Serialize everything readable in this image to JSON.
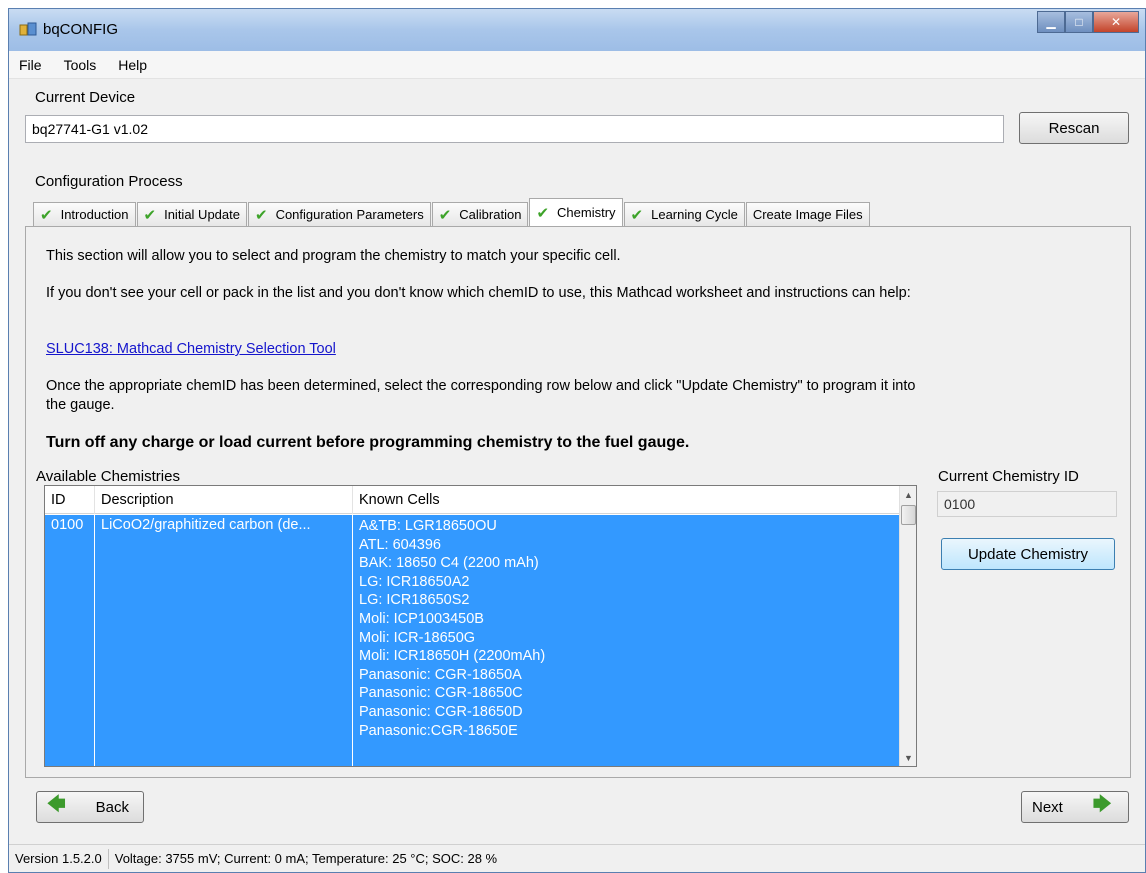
{
  "window": {
    "title": "bqCONFIG"
  },
  "menu": {
    "file": "File",
    "tools": "Tools",
    "help": "Help"
  },
  "current_device": {
    "label": "Current Device",
    "value": "bq27741-G1 v1.02",
    "rescan_label": "Rescan"
  },
  "config": {
    "label": "Configuration Process",
    "tabs": [
      {
        "label": "Introduction",
        "checked": true
      },
      {
        "label": "Initial Update",
        "checked": true
      },
      {
        "label": "Configuration Parameters",
        "checked": true
      },
      {
        "label": "Calibration",
        "checked": true
      },
      {
        "label": "Chemistry",
        "checked": true,
        "active": true
      },
      {
        "label": "Learning Cycle",
        "checked": true
      },
      {
        "label": "Create Image Files",
        "checked": false
      }
    ]
  },
  "chemistry": {
    "intro": "This section will allow you to select and program the chemistry to match your specific cell.",
    "help_text": "If you don't see your cell or pack in the list and you don't know which chemID to use, this Mathcad worksheet and instructions can help:",
    "link": "SLUC138: Mathcad Chemistry Selection Tool",
    "instructions": "Once the appropriate chemID has been determined, select the corresponding row below and click \"Update Chemistry\" to program it into the gauge.",
    "warning": "Turn off any charge or load current before programming chemistry to the fuel gauge.",
    "available_label": "Available Chemistries",
    "columns": {
      "id": "ID",
      "description": "Description",
      "known_cells": "Known Cells"
    },
    "selected_row": {
      "id": "0100",
      "description": "LiCoO2/graphitized carbon (de...",
      "known_cells": [
        "A&TB: LGR18650OU",
        "ATL: 604396",
        "BAK: 18650 C4 (2200 mAh)",
        "LG: ICR18650A2",
        "LG: ICR18650S2",
        "Moli: ICP1003450B",
        "Moli: ICR-18650G",
        "Moli: ICR18650H (2200mAh)",
        "Panasonic: CGR-18650A",
        "Panasonic: CGR-18650C",
        "Panasonic: CGR-18650D",
        "Panasonic:CGR-18650E"
      ]
    },
    "current_id_label": "Current Chemistry ID",
    "current_id_value": "0100",
    "update_label": "Update Chemistry"
  },
  "nav": {
    "back_label": "Back",
    "next_label": "Next"
  },
  "status": {
    "version": "Version 1.5.2.0",
    "readings": "Voltage: 3755 mV; Current: 0 mA; Temperature: 25 °C; SOC: 28 %"
  },
  "colors": {
    "selection": "#3399ff",
    "check": "#3da329",
    "link": "#1515cc"
  }
}
